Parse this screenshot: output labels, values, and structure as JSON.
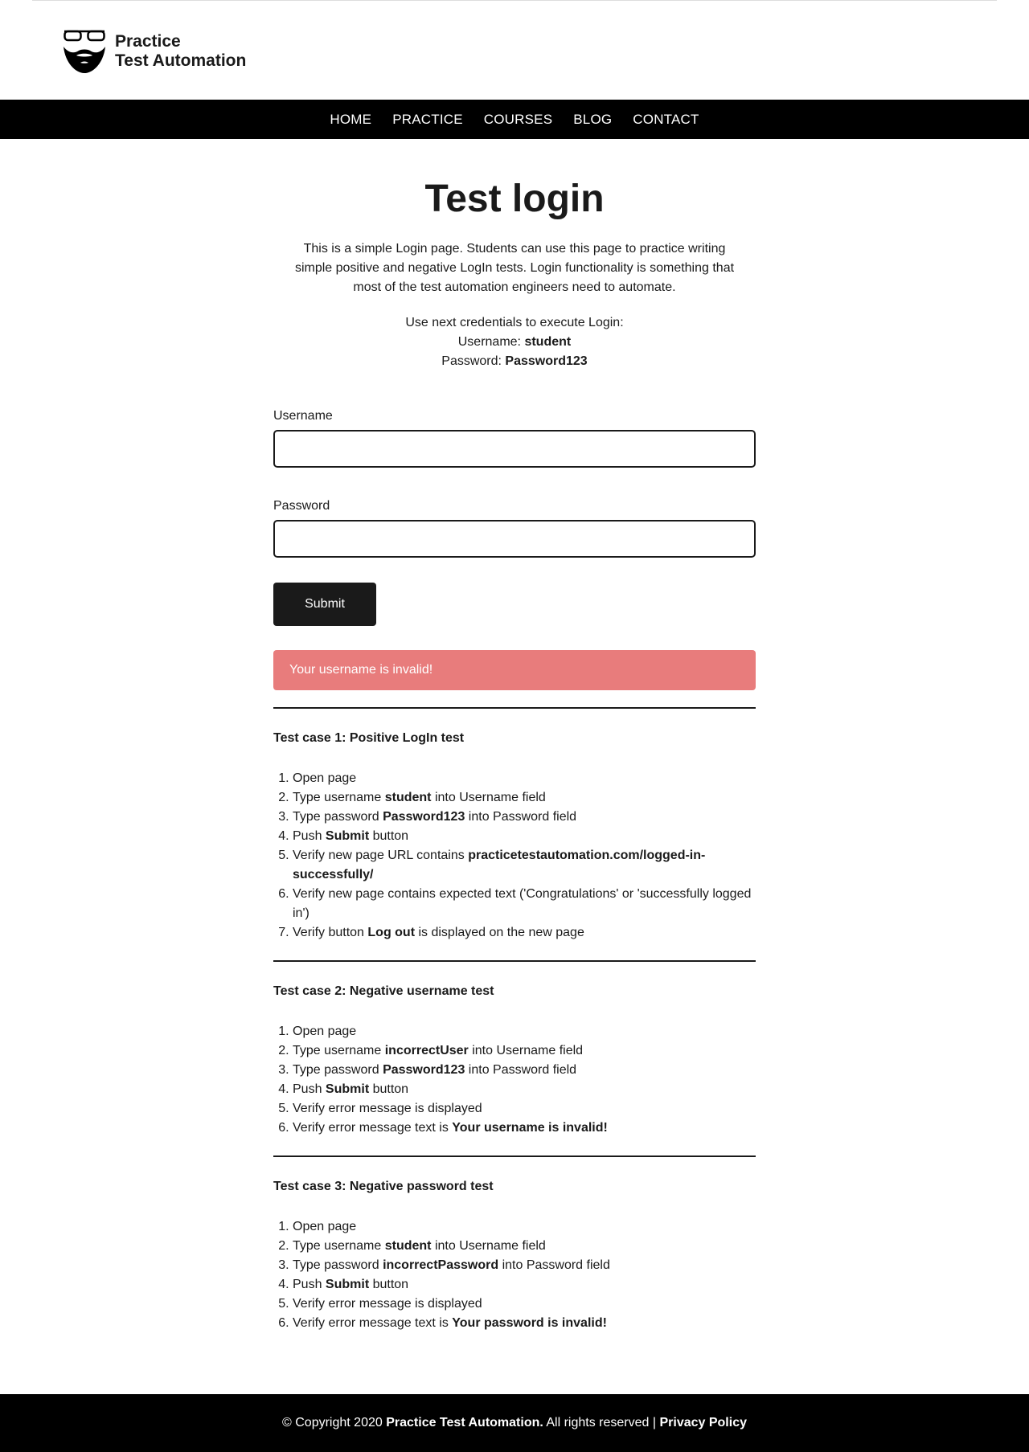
{
  "brand": {
    "line1": "Practice",
    "line2": "Test Automation"
  },
  "nav": [
    "HOME",
    "PRACTICE",
    "COURSES",
    "BLOG",
    "CONTACT"
  ],
  "page": {
    "title": "Test login",
    "intro": "This is a simple Login page. Students can use this page to practice writing simple positive and negative LogIn tests. Login functionality is something that most of the test automation engineers need to automate.",
    "creds_intro": "Use next credentials to execute Login:",
    "username_prefix": "Username: ",
    "username_value": "student",
    "password_prefix": "Password: ",
    "password_value": "Password123"
  },
  "form": {
    "username_label": "Username",
    "username_value": "",
    "password_label": "Password",
    "password_value": "",
    "submit_label": "Submit",
    "error_message": "Your username is invalid!"
  },
  "cases": [
    {
      "title": "Test case 1: Positive LogIn test",
      "steps": [
        [
          {
            "t": "Open page"
          }
        ],
        [
          {
            "t": "Type username "
          },
          {
            "b": "student"
          },
          {
            "t": " into Username field"
          }
        ],
        [
          {
            "t": "Type password "
          },
          {
            "b": "Password123"
          },
          {
            "t": " into Password field"
          }
        ],
        [
          {
            "t": "Push "
          },
          {
            "b": "Submit"
          },
          {
            "t": " button"
          }
        ],
        [
          {
            "t": "Verify new page URL contains "
          },
          {
            "b": "practicetestautomation.com/logged-in-successfully/"
          }
        ],
        [
          {
            "t": "Verify new page contains expected text ('Congratulations' or 'successfully logged in')"
          }
        ],
        [
          {
            "t": "Verify button "
          },
          {
            "b": "Log out"
          },
          {
            "t": " is displayed on the new page"
          }
        ]
      ]
    },
    {
      "title": "Test case 2: Negative username test",
      "steps": [
        [
          {
            "t": "Open page"
          }
        ],
        [
          {
            "t": "Type username "
          },
          {
            "b": "incorrectUser"
          },
          {
            "t": " into Username field"
          }
        ],
        [
          {
            "t": "Type password "
          },
          {
            "b": "Password123"
          },
          {
            "t": " into Password field"
          }
        ],
        [
          {
            "t": "Push "
          },
          {
            "b": "Submit"
          },
          {
            "t": " button"
          }
        ],
        [
          {
            "t": "Verify error message is displayed"
          }
        ],
        [
          {
            "t": "Verify error message text is "
          },
          {
            "b": "Your username is invalid!"
          }
        ]
      ]
    },
    {
      "title": "Test case 3: Negative password test",
      "steps": [
        [
          {
            "t": "Open page"
          }
        ],
        [
          {
            "t": "Type username "
          },
          {
            "b": "student"
          },
          {
            "t": " into Username field"
          }
        ],
        [
          {
            "t": "Type password "
          },
          {
            "b": "incorrectPassword"
          },
          {
            "t": " into Password field"
          }
        ],
        [
          {
            "t": "Push "
          },
          {
            "b": "Submit"
          },
          {
            "t": " button"
          }
        ],
        [
          {
            "t": "Verify error message is displayed"
          }
        ],
        [
          {
            "t": "Verify error message text is "
          },
          {
            "b": "Your password is invalid!"
          }
        ]
      ]
    }
  ],
  "footer": {
    "prefix": "© Copyright 2020 ",
    "brand": "Practice Test Automation.",
    "middle": " All rights reserved | ",
    "link": "Privacy Policy"
  },
  "colors": {
    "nav_bg": "#000000",
    "error_bg": "#e87c7c",
    "button_bg": "#1a1a1a"
  },
  "icons": [
    "glasses-beard-logo-icon"
  ]
}
